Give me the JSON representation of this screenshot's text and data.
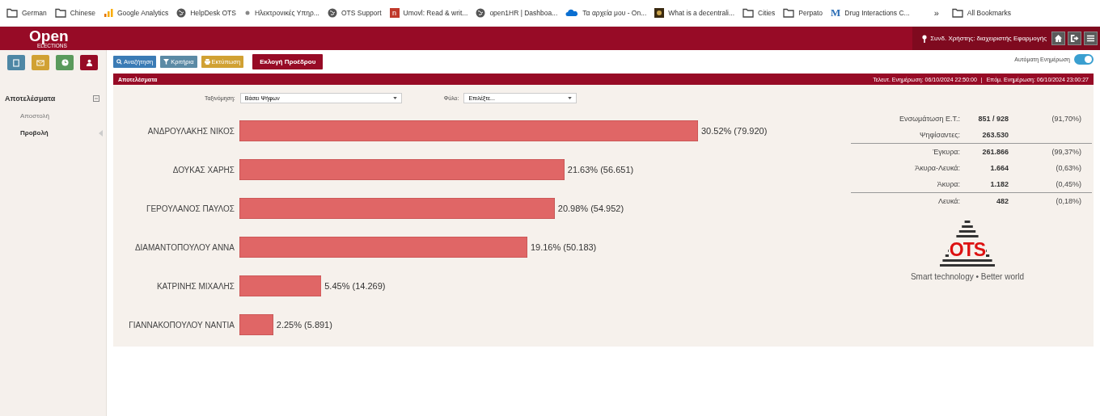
{
  "bookmarks": [
    {
      "kind": "folder",
      "label": "German"
    },
    {
      "kind": "folder",
      "label": "Chinese"
    },
    {
      "kind": "analytics",
      "label": "Google Analytics"
    },
    {
      "kind": "globe",
      "label": "HelpDesk OTS"
    },
    {
      "kind": "dot",
      "label": "Ηλεκτρονικές Υπηρ..."
    },
    {
      "kind": "globe",
      "label": "OTS Support"
    },
    {
      "kind": "letter",
      "glyph": "n",
      "label": "Umovl: Read & writ..."
    },
    {
      "kind": "globe",
      "label": "open1HR | Dashboa..."
    },
    {
      "kind": "cloud",
      "label": "Τα αρχεία μου - On..."
    },
    {
      "kind": "thumb",
      "label": "What is a decentrali..."
    },
    {
      "kind": "folder",
      "label": "Cities"
    },
    {
      "kind": "folder",
      "label": "Perpato"
    },
    {
      "kind": "mletter",
      "glyph": "M",
      "label": "Drug Interactions C..."
    }
  ],
  "bookmarks_more": "»",
  "all_bookmarks": "All Bookmarks",
  "header": {
    "logo": "Open",
    "logo_sub": "ELECTIONS",
    "user": "Συνδ. Χρήστης: διαχειριστής Εφαρμογής"
  },
  "sidebar": {
    "section": "Αποτελέσματα",
    "items": [
      {
        "label": "Αποστολή",
        "selected": false
      },
      {
        "label": "Προβολή",
        "selected": true
      }
    ]
  },
  "toolbar": [
    {
      "kind": "search",
      "label": "Αναζήτηση"
    },
    {
      "kind": "filter",
      "label": "Κριτήρια"
    },
    {
      "kind": "print",
      "label": "Εκτύπωση"
    },
    {
      "kind": "primary",
      "label": "Εκλογή Προέδρου"
    }
  ],
  "auto_refresh": {
    "label": "Αυτόματη Ενημέρωση",
    "on": true
  },
  "panel": {
    "title": "Αποτελέσματα",
    "last_update": "Τελευτ. Ενημέρωση: 06/10/2024 22:50:00",
    "next_update": "Επόμ. Ενημέρωση: 06/10/2024 23:00:27",
    "separator": "|"
  },
  "filters": [
    {
      "label": "Ταξινόμηση:",
      "value": "Βάσει Ψήφων"
    },
    {
      "label": "Φύλο:",
      "value": "Επιλέξτε..."
    }
  ],
  "chart_data": {
    "type": "bar",
    "orientation": "horizontal",
    "categories": [
      "ΑΝΔΡΟΥΛΑΚΗΣ ΝΙΚΟΣ",
      "ΔΟΥΚΑΣ ΧΑΡΗΣ",
      "ΓΕΡΟΥΛΑΝΟΣ ΠΑΥΛΟΣ",
      "ΔΙΑΜΑΝΤΟΠΟΥΛΟΥ ΑΝΝΑ",
      "ΚΑΤΡΙΝΗΣ ΜΙΧΑΛΗΣ",
      "ΓΙΑΝΝΑΚΟΠΟΥΛΟΥ ΝΑΝΤΙΑ"
    ],
    "series": [
      {
        "color": "#e06666",
        "values": [
          30.52,
          21.63,
          20.98,
          19.16,
          5.45,
          2.25
        ],
        "value_labels": [
          "30.52% (79.920)",
          "21.63% (56.651)",
          "20.98% (54.952)",
          "19.16% (50.183)",
          "5.45% (14.269)",
          "2.25% (5.891)"
        ]
      }
    ]
  },
  "stats": [
    {
      "label": "Ενσωμάτωση Ε.Τ.:",
      "value": "851 / 928",
      "share": "(91,70%)",
      "rule_below": false
    },
    {
      "label": "Ψηφίσαντες:",
      "value": "263.530",
      "rule_below": true
    },
    {
      "label": "Έγκυρα:",
      "value": "261.866",
      "share": "(99,37%)",
      "rule_below": false
    },
    {
      "label": "Άκυρα-Λευκά:",
      "value": "1.664",
      "share": "(0,63%)",
      "rule_below": false
    },
    {
      "label": "Άκυρα:",
      "value": "1.182",
      "share": "(0,45%)",
      "rule_below": true
    },
    {
      "label": "Λευκά:",
      "value": "482",
      "share": "(0,18%)",
      "rule_below": false
    }
  ],
  "brand": {
    "logo": "OTS",
    "tagline": "Smart technology • Better world"
  }
}
